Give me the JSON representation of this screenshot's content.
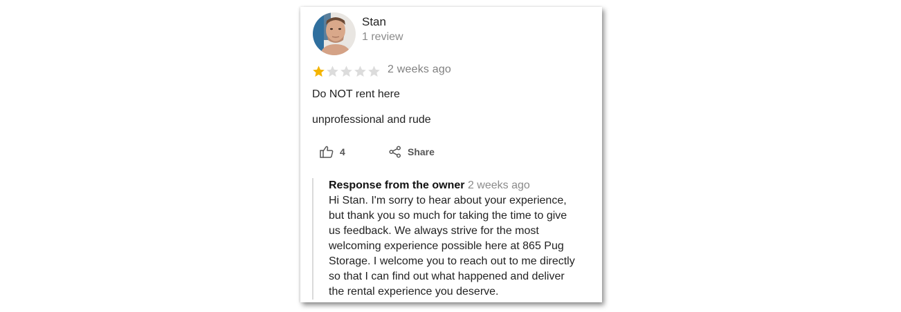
{
  "reviewer": {
    "name": "Stan",
    "review_count": "1 review",
    "avatar_icon": "user-photo"
  },
  "rating": {
    "stars_filled": 1,
    "stars_total": 5,
    "filled_color": "#f4b400",
    "empty_color": "#dcdcdc"
  },
  "review": {
    "date": "2 weeks ago",
    "lines": [
      "Do NOT rent here",
      "unprofessional and rude"
    ]
  },
  "actions": {
    "like_icon": "thumbs-up-icon",
    "like_count": "4",
    "share_icon": "share-icon",
    "share_label": "Share"
  },
  "owner_response": {
    "title": "Response from the owner",
    "date": "2 weeks ago",
    "lines": [
      "Hi Stan. I'm sorry to hear about your experience,",
      "but thank you so much for taking the time to give",
      "us feedback. We always strive for the most",
      "welcoming experience possible here at 865 Pug",
      "Storage. I welcome you to reach out to me directly",
      "so that I can find out what happened and deliver",
      "the rental experience you deserve."
    ]
  }
}
